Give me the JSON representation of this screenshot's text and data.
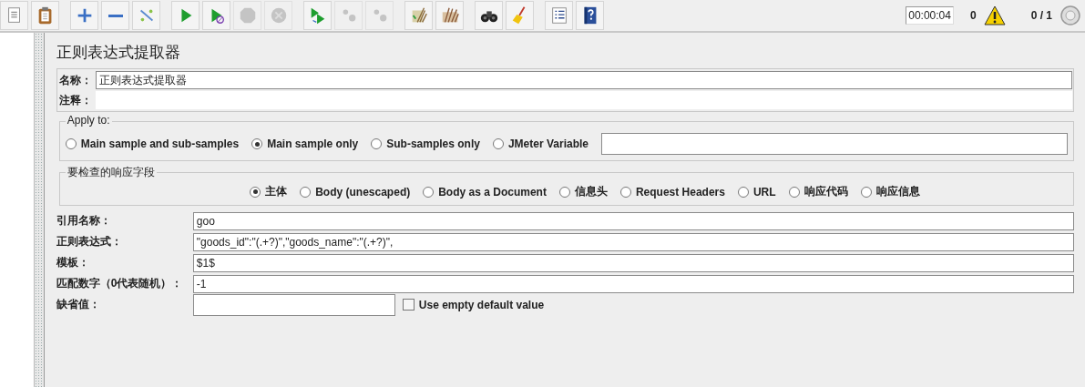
{
  "toolbar": {
    "groups": [
      [
        {
          "kind": "document",
          "disabled": false
        },
        {
          "kind": "clipboard",
          "disabled": false
        }
      ],
      [
        {
          "kind": "plus",
          "disabled": false
        },
        {
          "kind": "minus",
          "disabled": false
        },
        {
          "kind": "wand",
          "disabled": false
        }
      ],
      [
        {
          "kind": "play",
          "disabled": false
        },
        {
          "kind": "play-no-timer",
          "disabled": false
        },
        {
          "kind": "stop",
          "disabled": true
        },
        {
          "kind": "shutdown",
          "disabled": true
        }
      ],
      [
        {
          "kind": "remote-start",
          "disabled": false
        },
        {
          "kind": "remote-stop",
          "disabled": true
        },
        {
          "kind": "remote-exit",
          "disabled": true
        }
      ],
      [
        {
          "kind": "clear",
          "disabled": false
        },
        {
          "kind": "clear-all",
          "disabled": false
        }
      ],
      [
        {
          "kind": "binoculars",
          "disabled": false
        },
        {
          "kind": "broom",
          "disabled": false
        }
      ],
      [
        {
          "kind": "function-list",
          "disabled": false
        },
        {
          "kind": "help",
          "disabled": false
        }
      ]
    ]
  },
  "status": {
    "timer": "00:00:04",
    "warnings": "0",
    "threads": "0 / 1"
  },
  "panel": {
    "title": "正则表达式提取器",
    "name": {
      "label": "名称：",
      "value": "正则表达式提取器"
    },
    "comment": {
      "label": "注释："
    },
    "apply_to": {
      "legend": "Apply to:",
      "options": [
        {
          "label": "Main sample and sub-samples",
          "selected": false
        },
        {
          "label": "Main sample only",
          "selected": true
        },
        {
          "label": "Sub-samples only",
          "selected": false
        },
        {
          "label": "JMeter Variable",
          "selected": false
        }
      ]
    },
    "field_to_check": {
      "legend": "要检查的响应字段",
      "options": [
        {
          "label": "主体",
          "selected": true
        },
        {
          "label": "Body (unescaped)",
          "selected": false
        },
        {
          "label": "Body as a Document",
          "selected": false
        },
        {
          "label": "信息头",
          "selected": false
        },
        {
          "label": "Request Headers",
          "selected": false
        },
        {
          "label": "URL",
          "selected": false
        },
        {
          "label": "响应代码",
          "selected": false
        },
        {
          "label": "响应信息",
          "selected": false
        }
      ]
    },
    "fields": [
      {
        "kind": "wide",
        "label": "引用名称：",
        "value": "goo"
      },
      {
        "kind": "wide",
        "label": "正则表达式：",
        "value": "\"goods_id\":\"(.+?)\",\"goods_name\":\"(.+?)\","
      },
      {
        "kind": "wide",
        "label": "模板：",
        "value": "$1$"
      },
      {
        "kind": "wide",
        "label": "匹配数字（0代表随机）：",
        "value": "-1"
      },
      {
        "kind": "short",
        "label": "缺省值：",
        "checkbox": {
          "label": "Use empty default value",
          "checked": false
        }
      }
    ]
  }
}
